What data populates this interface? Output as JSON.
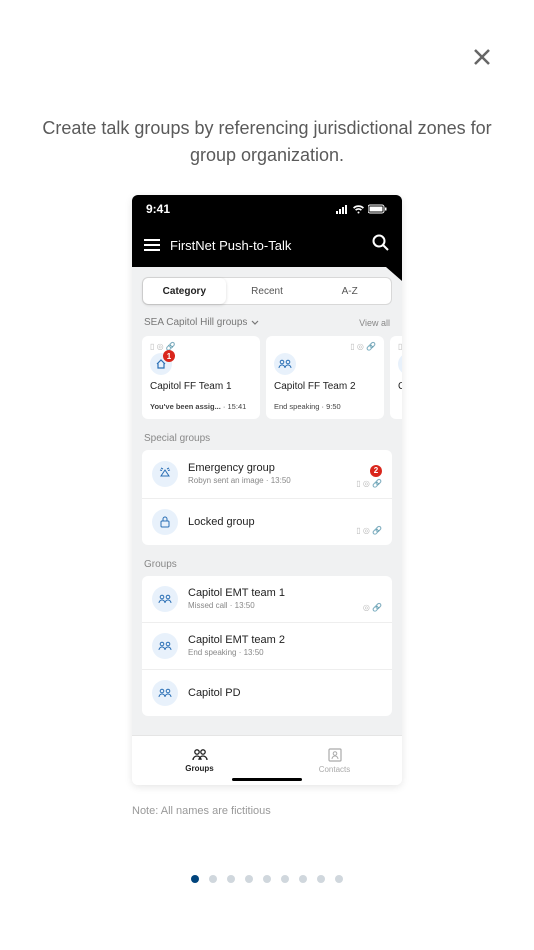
{
  "heading": "Create talk groups by referencing jurisdictional zones for group organization.",
  "footnote": "Note: All names are fictitious",
  "status": {
    "time": "9:41"
  },
  "app": {
    "title": "FirstNet Push-to-Talk"
  },
  "tabs": {
    "category": "Category",
    "recent": "Recent",
    "az": "A-Z"
  },
  "zone": {
    "label": "SEA Capitol Hill groups",
    "view_all": "View all"
  },
  "cards": [
    {
      "name": "Capitol FF Team 1",
      "sub_bold": "You've been assig...",
      "sub_time": "15:41",
      "badge": "1",
      "icon": "home"
    },
    {
      "name": "Capitol FF Team 2",
      "sub": "End speaking",
      "sub_time": "9:50",
      "icon": "group"
    },
    {
      "name": "Ca"
    }
  ],
  "sections": {
    "special": {
      "title": "Special groups",
      "items": [
        {
          "name": "Emergency group",
          "sub": "Robyn sent an image · 13:50",
          "badge": "2",
          "icon": "alert"
        },
        {
          "name": "Locked group",
          "icon": "lock"
        }
      ]
    },
    "groups": {
      "title": "Groups",
      "items": [
        {
          "name": "Capitol EMT team 1",
          "sub": "Missed call · 13:50",
          "icon": "group"
        },
        {
          "name": "Capitol EMT team 2",
          "sub": "End speaking · 13:50",
          "icon": "group"
        },
        {
          "name": "Capitol PD",
          "icon": "group"
        }
      ]
    }
  },
  "nav": {
    "groups": "Groups",
    "contacts": "Contacts"
  },
  "pagination": {
    "total": 9,
    "active": 0
  }
}
